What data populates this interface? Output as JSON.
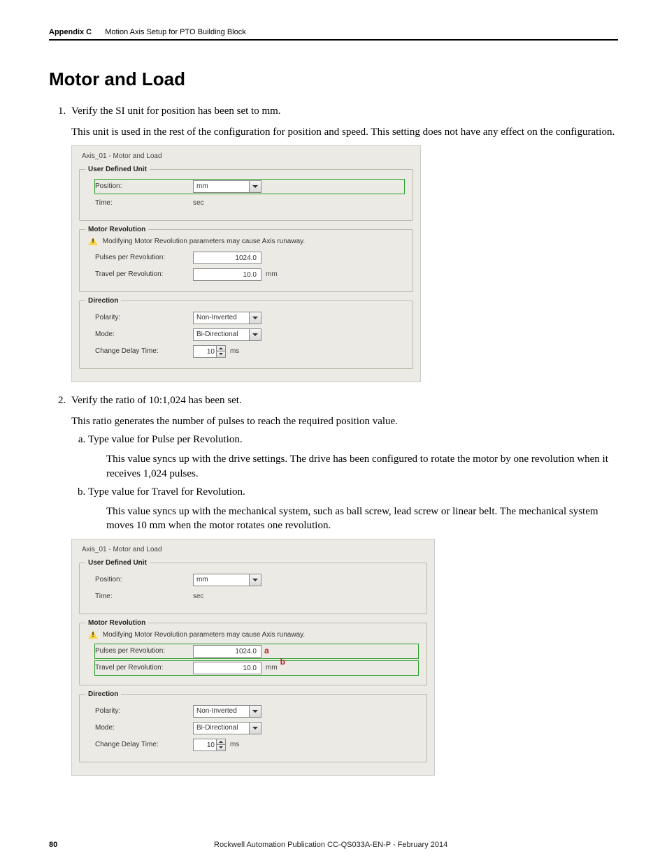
{
  "header": {
    "appendix": "Appendix C",
    "subtitle": "Motion Axis Setup for PTO Building Block"
  },
  "heading": "Motor and Load",
  "list1": {
    "item1_lead": "Verify the SI unit for position has been set to mm.",
    "item1_p1": "This unit is used in the rest of the configuration for position and speed. This setting does not have any effect on the configuration.",
    "item2_lead": "Verify the ratio of 10:1,024 has been set.",
    "item2_p1": "This ratio generates the number of pulses to reach the required position value.",
    "sub_a_lead": "Type value for Pulse per Revolution.",
    "sub_a_p1": "This value syncs up with the drive settings. The drive has been configured to rotate the motor by one revolution when it receives 1,024 pulses.",
    "sub_b_lead": "Type value for Travel for Revolution.",
    "sub_b_p1": "This value syncs up with the mechanical system, such as ball screw, lead screw or linear belt. The mechanical system moves 10 mm when the motor rotates one revolution."
  },
  "screenshot_common": {
    "frame_title": "Axis_01 - Motor and Load",
    "grp_user_defined": "User Defined Unit",
    "position_label": "Position:",
    "position_value": "mm",
    "time_label": "Time:",
    "time_value": "sec",
    "grp_motor_rev": "Motor Revolution",
    "warn_text": "Modifying Motor Revolution parameters may cause Axis runaway.",
    "pulses_label": "Pulses per Revolution:",
    "pulses_value": "1024.0",
    "travel_label": "Travel per Revolution:",
    "travel_value": "10.0",
    "travel_unit": "mm",
    "grp_direction": "Direction",
    "polarity_label": "Polarity:",
    "polarity_value": "Non-Inverted",
    "mode_label": "Mode:",
    "mode_value": "Bi-Directional",
    "delay_label": "Change Delay Time:",
    "delay_value": "10",
    "delay_unit": "ms"
  },
  "annot": {
    "a": "a",
    "b": "b"
  },
  "footer": {
    "page": "80",
    "publication": "Rockwell Automation Publication CC-QS033A-EN-P - February 2014"
  }
}
